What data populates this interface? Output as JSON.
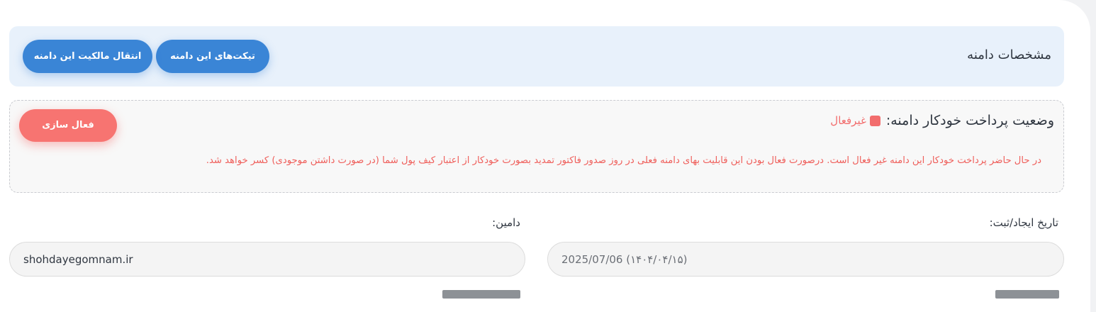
{
  "header": {
    "title": "مشخصات دامنه",
    "tickets_button": "تیکت‌های این دامنه",
    "transfer_button": "انتقال مالکیت این دامنه"
  },
  "autopay": {
    "title": "وضعیت پرداخت خودکار دامنه:",
    "status_label": "غیرفعال",
    "status_color": "#f26d6d",
    "activate_button": "فعال سازی",
    "description": "در حال حاضر پرداخت خودکار این دامنه غیر فعال است. درصورت فعال بودن این قابلیت بهای دامنه فعلی در روز صدور فاکتور تمدید بصورت خودکار از اعتبار کیف پول شما (در صورت داشتن موجودی) کسر خواهد شد."
  },
  "fields": {
    "created_label": "تاریخ ایجاد/ثبت:",
    "created_value": "2025/07/06 (۱۴۰۴/۰۴/۱۵)",
    "domain_label": "دامین:",
    "domain_value": "shohdayegomnam.ir"
  },
  "colors": {
    "accent_blue": "#3a85d6",
    "danger": "#f77471",
    "header_bg": "#e8f1fb"
  }
}
